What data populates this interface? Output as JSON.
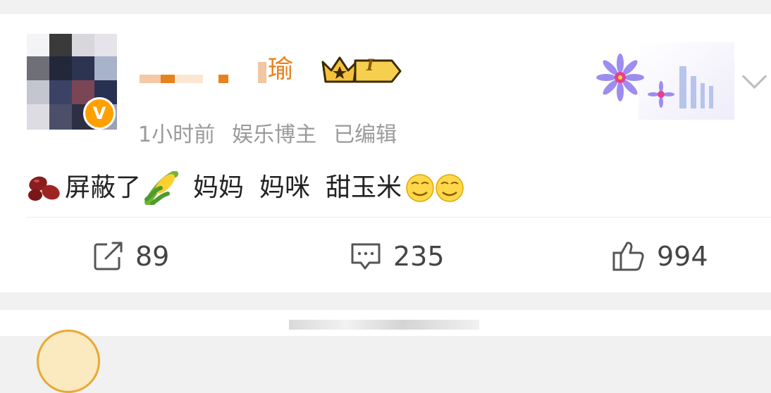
{
  "post": {
    "author_name_visible": "瑜",
    "level_badge": "I",
    "verified_badge": "V",
    "timestamp": "1小时前",
    "author_role": "娱乐博主",
    "edited": "已编辑",
    "content": {
      "emoji_beans": "beans-emoji",
      "text_1": "屏蔽了",
      "emoji_corn": "corn-emoji",
      "text_2": "妈妈",
      "text_3": "妈咪",
      "text_4": "甜玉米",
      "emoji_smile": "smirk-face-emoji"
    },
    "actions": {
      "repost_icon": "share-icon",
      "repost_count": "89",
      "comment_icon": "comment-icon",
      "comment_count": "235",
      "like_icon": "thumbs-up-icon",
      "like_count": "994"
    }
  },
  "colors": {
    "name": "#e8821c",
    "meta": "#9a9a9a",
    "text": "#222222",
    "badge": "#ffa000"
  }
}
